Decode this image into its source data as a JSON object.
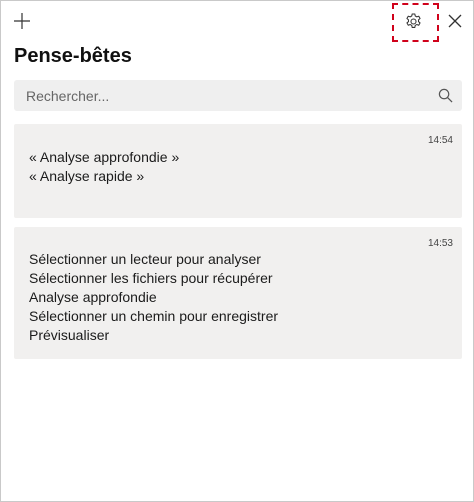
{
  "header": {
    "title": "Pense-bêtes",
    "add_icon": "plus-icon",
    "settings_icon": "gear-icon",
    "close_icon": "close-icon",
    "highlight_color": "#d0021b"
  },
  "search": {
    "placeholder": "Rechercher...",
    "value": "",
    "icon": "search-icon"
  },
  "notes": [
    {
      "time": "14:54",
      "lines": [
        "« Analyse approfondie »",
        "« Analyse rapide »"
      ]
    },
    {
      "time": "14:53",
      "lines": [
        "Sélectionner un lecteur pour analyser",
        "Sélectionner les fichiers pour récupérer",
        "Analyse approfondie",
        "Sélectionner un chemin pour enregistrer",
        "Prévisualiser"
      ]
    }
  ]
}
